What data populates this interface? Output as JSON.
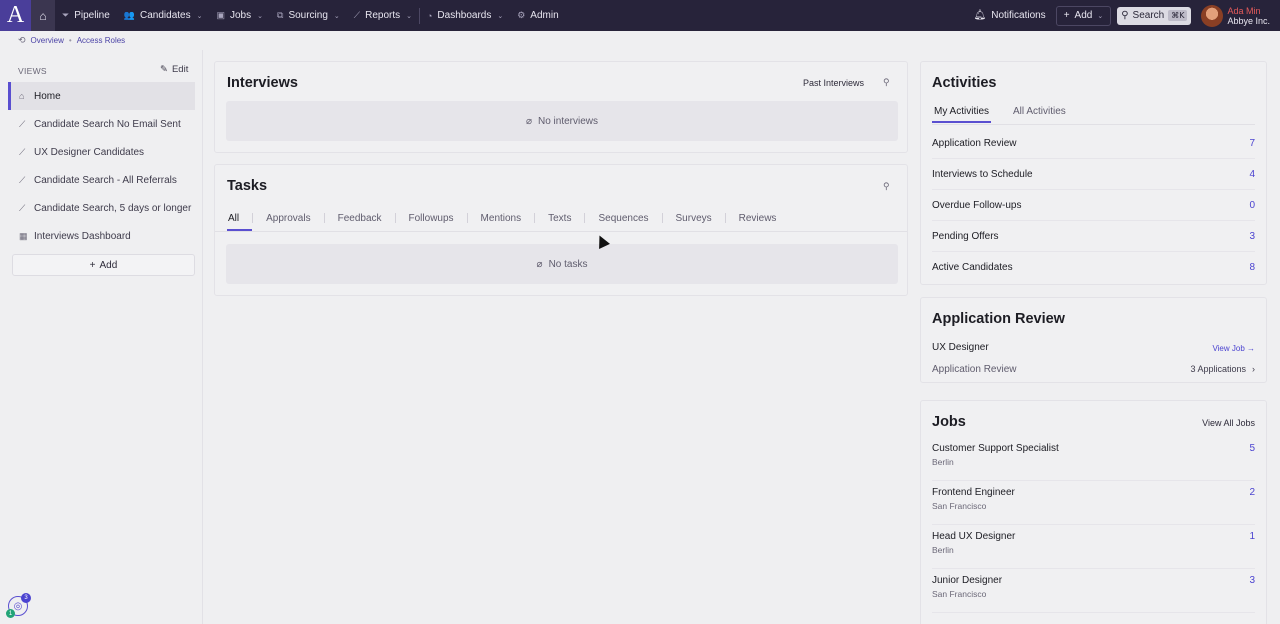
{
  "topbar": {
    "logo": "A",
    "nav": [
      {
        "label": "Pipeline",
        "icon": "filter-icon",
        "glyph": "⏷",
        "chevron": false
      },
      {
        "label": "Candidates",
        "icon": "people-icon",
        "glyph": "👥",
        "chevron": true
      },
      {
        "label": "Jobs",
        "icon": "briefcase-icon",
        "glyph": "▣",
        "chevron": true
      },
      {
        "label": "Sourcing",
        "icon": "sourcing-icon",
        "glyph": "⧉",
        "chevron": true
      },
      {
        "label": "Reports",
        "icon": "chart-icon",
        "glyph": "⟋",
        "chevron": true
      },
      {
        "label": "Dashboards",
        "icon": "gauge-icon",
        "glyph": "◔",
        "chevron": true
      },
      {
        "label": "Admin",
        "icon": "gear-icon",
        "glyph": "⚙",
        "chevron": false
      }
    ],
    "notifications": "Notifications",
    "add": "Add",
    "search": "Search",
    "shortcut": "⌘K",
    "user_name": "Ada Min",
    "user_org": "Abbye Inc."
  },
  "breadcrumb": [
    "Overview",
    "Access Roles"
  ],
  "sidebar": {
    "views_label": "VIEWS",
    "edit_label": "Edit",
    "items": [
      {
        "label": "Home",
        "icon": "home-icon",
        "glyph": "⌂",
        "active": true
      },
      {
        "label": "Candidate Search No Email Sent",
        "icon": "chart-line-icon",
        "glyph": "⟋",
        "active": false
      },
      {
        "label": "UX Designer Candidates",
        "icon": "chart-line-icon",
        "glyph": "⟋",
        "active": false
      },
      {
        "label": "Candidate Search - All Referrals",
        "icon": "chart-line-icon",
        "glyph": "⟋",
        "active": false
      },
      {
        "label": "Candidate Search, 5 days or longer",
        "icon": "chart-line-icon",
        "glyph": "⟋",
        "active": false
      },
      {
        "label": "Interviews Dashboard",
        "icon": "calendar-icon",
        "glyph": "▦",
        "active": false
      }
    ],
    "add_label": "Add",
    "help_badge": "3",
    "help_badge_small": "1"
  },
  "interviews": {
    "title": "Interviews",
    "past_link": "Past Interviews",
    "empty": "No interviews"
  },
  "tasks": {
    "title": "Tasks",
    "tabs": [
      "All",
      "Approvals",
      "Feedback",
      "Followups",
      "Mentions",
      "Texts",
      "Sequences",
      "Surveys",
      "Reviews"
    ],
    "active_tab": "All",
    "empty": "No tasks"
  },
  "activities": {
    "title": "Activities",
    "tabs": [
      "My Activities",
      "All Activities"
    ],
    "rows": [
      {
        "label": "Application Review",
        "count": "7"
      },
      {
        "label": "Interviews to Schedule",
        "count": "4"
      },
      {
        "label": "Overdue Follow-ups",
        "count": "0"
      },
      {
        "label": "Pending Offers",
        "count": "3"
      },
      {
        "label": "Active Candidates",
        "count": "8"
      }
    ]
  },
  "application_review": {
    "title": "Application Review",
    "job": "UX Designer",
    "view_job": "View Job →",
    "stage": "Application Review",
    "applications": "3 Applications"
  },
  "jobs": {
    "title": "Jobs",
    "view_all": "View All Jobs",
    "rows": [
      {
        "title": "Customer Support Specialist",
        "location": "Berlin",
        "count": "5"
      },
      {
        "title": "Frontend Engineer",
        "location": "San Francisco",
        "count": "2"
      },
      {
        "title": "Head UX Designer",
        "location": "Berlin",
        "count": "1"
      },
      {
        "title": "Junior Designer",
        "location": "San Francisco",
        "count": "3"
      }
    ]
  },
  "colors": {
    "topbar": "#27233a",
    "accent": "#5a4fd0",
    "logo": "#4a3e9a"
  }
}
